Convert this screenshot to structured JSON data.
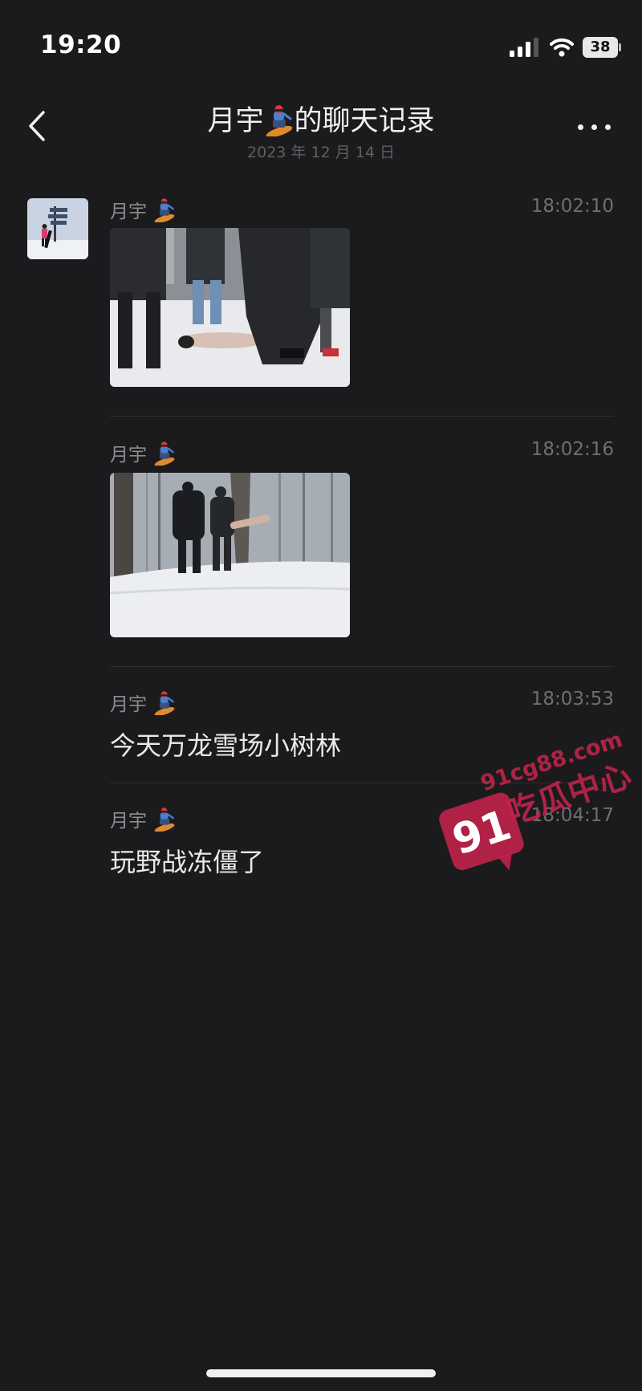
{
  "status_bar": {
    "time": "19:20",
    "battery": "38"
  },
  "header": {
    "title_name": "月宇",
    "title_suffix": "的聊天记录",
    "date": "2023 年 12 月 14 日"
  },
  "messages": [
    {
      "sender": "月宇",
      "time": "18:02:10",
      "type": "image"
    },
    {
      "sender": "月宇",
      "time": "18:02:16",
      "type": "image"
    },
    {
      "sender": "月宇",
      "time": "18:03:53",
      "type": "text",
      "text": "今天万龙雪场小树林"
    },
    {
      "sender": "月宇",
      "time": "18:04:17",
      "type": "text",
      "text": "玩野战冻僵了"
    }
  ],
  "watermark": {
    "number": "91",
    "domain": "91cg88.com",
    "name": "吃瓜中心"
  },
  "icons": {
    "back": "chevron-left-icon",
    "more": "more-dots-icon",
    "sender_emoji": "snowboarder-emoji-icon",
    "signal": "cellular-signal-icon",
    "wifi": "wifi-icon",
    "battery": "battery-icon"
  },
  "colors": {
    "background": "#1b1b1d",
    "watermark": "#c0234a"
  }
}
